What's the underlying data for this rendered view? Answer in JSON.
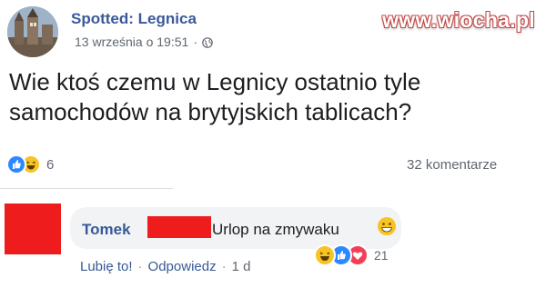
{
  "page": {
    "name": "Spotted: Legnica",
    "date": "13 września o 19:51",
    "separator": "·"
  },
  "watermark": "www.wiocha.pl",
  "post": {
    "line1": "Wie ktoś czemu w Legnicy ostatnio tyle",
    "line2": "samochodów na brytyjskich tablicach?",
    "reaction_count": "6",
    "comments_count": "32 komentarze"
  },
  "comment": {
    "author": "Tomek",
    "text": "Urlop na zmywaku",
    "reaction_count": "21",
    "actions": {
      "like": "Lubię to!",
      "sep1": "·",
      "reply": "Odpowiedz",
      "sep2": "·",
      "time": "1 d"
    }
  },
  "icons": {
    "globe": "globe-icon",
    "like": "like-reaction-icon",
    "haha": "haha-reaction-icon",
    "love": "love-reaction-icon",
    "smile": "grin-emoji-icon"
  },
  "colors": {
    "link": "#3b5998",
    "like": "#2d88ff",
    "haha": "#f7c325",
    "love": "#f33e58",
    "redaction": "#ee1c1c"
  }
}
